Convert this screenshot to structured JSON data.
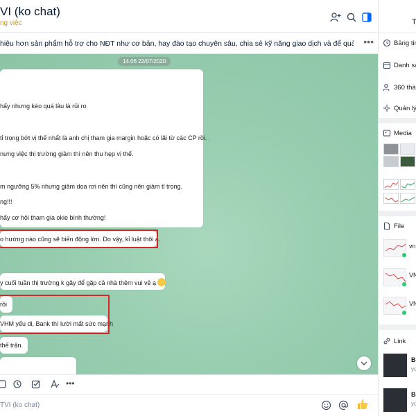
{
  "header": {
    "title": "VI (ko chat)",
    "subtitle": "ng việc",
    "icons": [
      "add-user-icon",
      "search-icon",
      "layout-icon"
    ]
  },
  "pinned": {
    "text": "hiệu hơn sản phẩm hỗ trợ cho NĐT như cơ bản, hay đào tạo chuyên sâu, chia sẻ kỹ năng giao dịch và để quản trị rủi ro cho Team trán...",
    "more": "•••"
  },
  "chat": {
    "timestamp": "14:06 22/07/2020",
    "bubble1": [
      "hấy nhưng kéo quá lâu là rủi ro",
      "tỉ trọng bớt vị thế nhất là anh chị tham gia margin hoặc có lãi từ các CP rồi.",
      "nưng việc thị trường giảm thì nên thu hẹp vị thế.",
      "m ngưỡng 5% nhưng giảm dọa rơi nên thì cũng nên giảm tỉ trọng.",
      "ng!!!",
      "hấy cơ hội tham gia okie bình thường!"
    ],
    "msg_highlight_1": "o hướng nào cũng sẽ biến động lớn. Do vậy, kỉ luật thôi ạ.",
    "msg_weekend": "y cuối tuần thị trường k gãy để gặp cả nhà thêm vui vẻ ạ",
    "msg_roi": "rồi",
    "msg_vhm": "VHM yếu di, Bank thì lười mất sức mạnh",
    "msg_the_tran": "thế trận."
  },
  "toolbar": {
    "icons": [
      "sticker-icon",
      "clock-icon",
      "checkbox-icon",
      "text-format-icon",
      "more-icon"
    ],
    "more_label": "•••"
  },
  "input": {
    "placeholder": "TVI (ko chat)",
    "icons": [
      "emoji-icon",
      "mention-icon",
      "thumbs-up-icon"
    ]
  },
  "right_panel": {
    "header_label": "T",
    "rows": [
      {
        "icon": "clock-icon",
        "label": "Bảng tin"
      },
      {
        "icon": "calendar-icon",
        "label": "Danh sá"
      },
      {
        "icon": "people-icon",
        "label": "360 thàn"
      },
      {
        "icon": "settings-icon",
        "label": "Quản lý"
      }
    ],
    "media_label": "Media",
    "file_label": "File",
    "files": [
      "vn",
      "VN",
      "VN"
    ],
    "link_label": "Link",
    "links": [
      {
        "title": "Ba",
        "sub": "yo"
      },
      {
        "title": "Ba",
        "sub": "yo"
      }
    ]
  },
  "colors": {
    "accent": "#0068ff",
    "highlight_box": "#d7262b",
    "chat_bg": "#98cdb0",
    "timestamp_bg": "rgba(128,140,134,0.45)"
  }
}
